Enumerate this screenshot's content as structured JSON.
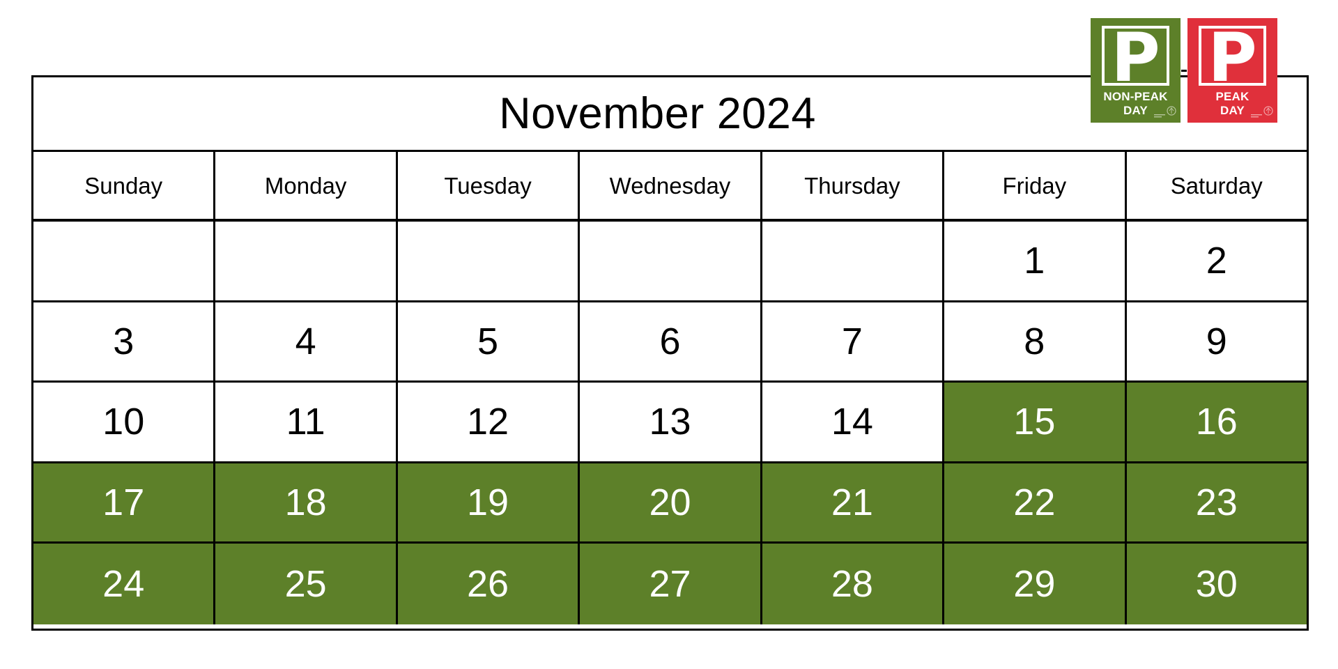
{
  "calendar": {
    "title": "November 2024",
    "weekdays": [
      "Sunday",
      "Monday",
      "Tuesday",
      "Wednesday",
      "Thursday",
      "Friday",
      "Saturday"
    ],
    "weeks": [
      [
        {
          "day": "",
          "highlight": false
        },
        {
          "day": "",
          "highlight": false
        },
        {
          "day": "",
          "highlight": false
        },
        {
          "day": "",
          "highlight": false
        },
        {
          "day": "",
          "highlight": false
        },
        {
          "day": "1",
          "highlight": false
        },
        {
          "day": "2",
          "highlight": false
        }
      ],
      [
        {
          "day": "3",
          "highlight": false
        },
        {
          "day": "4",
          "highlight": false
        },
        {
          "day": "5",
          "highlight": false
        },
        {
          "day": "6",
          "highlight": false
        },
        {
          "day": "7",
          "highlight": false
        },
        {
          "day": "8",
          "highlight": false
        },
        {
          "day": "9",
          "highlight": false
        }
      ],
      [
        {
          "day": "10",
          "highlight": false
        },
        {
          "day": "11",
          "highlight": false
        },
        {
          "day": "12",
          "highlight": false
        },
        {
          "day": "13",
          "highlight": false
        },
        {
          "day": "14",
          "highlight": false
        },
        {
          "day": "15",
          "highlight": true
        },
        {
          "day": "16",
          "highlight": true
        }
      ],
      [
        {
          "day": "17",
          "highlight": true
        },
        {
          "day": "18",
          "highlight": true
        },
        {
          "day": "19",
          "highlight": true
        },
        {
          "day": "20",
          "highlight": true
        },
        {
          "day": "21",
          "highlight": true
        },
        {
          "day": "22",
          "highlight": true
        },
        {
          "day": "23",
          "highlight": true
        }
      ],
      [
        {
          "day": "24",
          "highlight": true
        },
        {
          "day": "25",
          "highlight": true
        },
        {
          "day": "26",
          "highlight": true
        },
        {
          "day": "27",
          "highlight": true
        },
        {
          "day": "28",
          "highlight": true
        },
        {
          "day": "29",
          "highlight": true
        },
        {
          "day": "30",
          "highlight": true
        }
      ]
    ]
  },
  "legend": {
    "separator": "-",
    "non_peak": {
      "symbol": "P",
      "line1": "NON-PEAK",
      "line2": "DAY",
      "color": "#5d8029"
    },
    "peak": {
      "symbol": "P",
      "line1": "PEAK",
      "line2": "DAY",
      "color": "#e0303b"
    }
  },
  "colors": {
    "highlight_green": "#5d8029",
    "peak_red": "#e0303b",
    "grid_line": "#000000",
    "cell_background": "#ffffff",
    "highlight_text": "#ffffff",
    "normal_text": "#000000"
  }
}
